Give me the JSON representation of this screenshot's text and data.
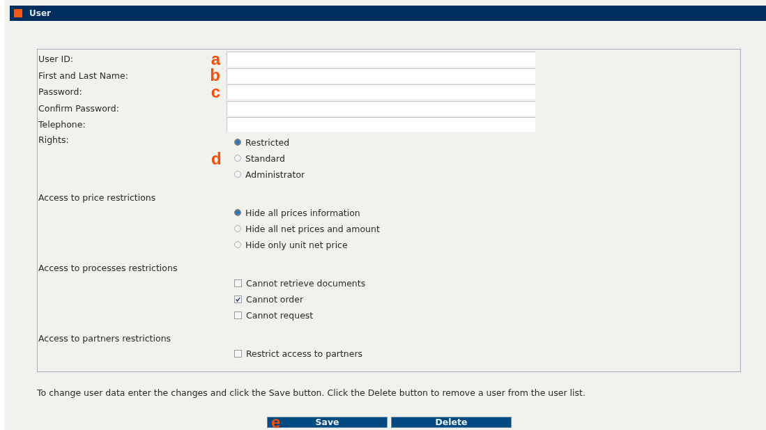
{
  "window": {
    "title": "User"
  },
  "fields": [
    {
      "label": "User ID:",
      "marker": "a"
    },
    {
      "label": "First and Last Name:",
      "marker": "b"
    },
    {
      "label": "Password:",
      "marker": "c"
    },
    {
      "label": "Confirm Password:"
    },
    {
      "label": "Telephone:"
    }
  ],
  "rights": {
    "label": "Rights:",
    "marker": "d",
    "options": [
      {
        "label": "Restricted",
        "selected": true
      },
      {
        "label": "Standard",
        "selected": false
      },
      {
        "label": "Administrator",
        "selected": false
      }
    ]
  },
  "sections": [
    {
      "heading": "Access to price restrictions",
      "kind": "radio",
      "options": [
        {
          "label": "Hide all prices information",
          "selected": true
        },
        {
          "label": "Hide all net prices and amount",
          "selected": false
        },
        {
          "label": "Hide only unit net price",
          "selected": false
        }
      ]
    },
    {
      "heading": "Access to processes restrictions",
      "kind": "checkbox",
      "options": [
        {
          "label": "Cannot retrieve documents",
          "checked": false
        },
        {
          "label": "Cannot order",
          "checked": true
        },
        {
          "label": "Cannot request",
          "checked": false
        }
      ]
    },
    {
      "heading": "Access to partners restrictions",
      "kind": "checkbox",
      "options": [
        {
          "label": "Restrict access to partners",
          "checked": false
        }
      ]
    }
  ],
  "help_text": "To change user data enter the changes and click the Save button. Click the Delete button to remove a user from the user list.",
  "buttons": [
    {
      "label": "Save",
      "marker": "e"
    },
    {
      "label": "Delete"
    }
  ]
}
